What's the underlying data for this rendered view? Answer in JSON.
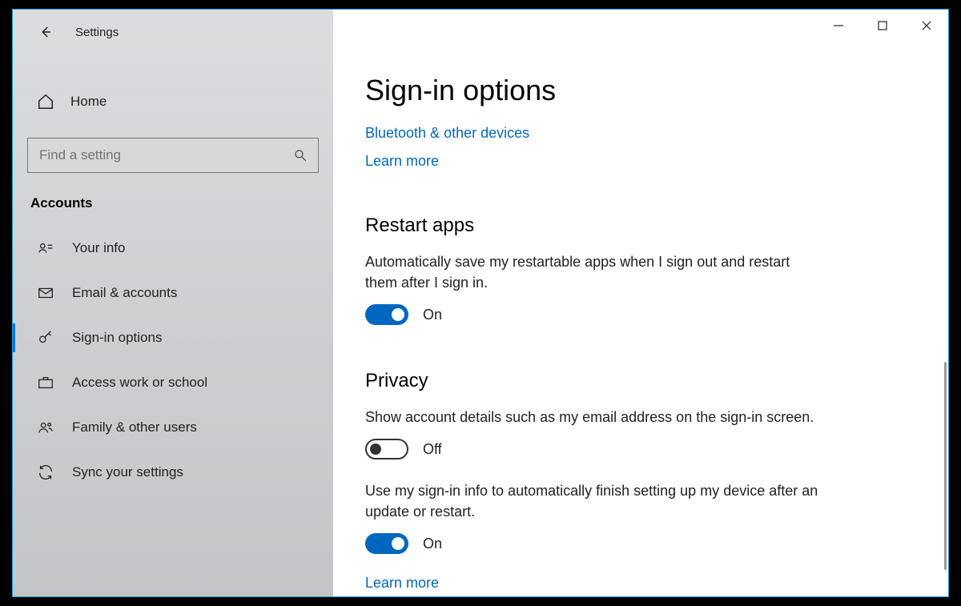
{
  "window": {
    "app_title": "Settings"
  },
  "sidebar": {
    "home_label": "Home",
    "search_placeholder": "Find a setting",
    "section_label": "Accounts",
    "items": [
      {
        "label": "Your info"
      },
      {
        "label": "Email & accounts"
      },
      {
        "label": "Sign-in options"
      },
      {
        "label": "Access work or school"
      },
      {
        "label": "Family & other users"
      },
      {
        "label": "Sync your settings"
      }
    ]
  },
  "main": {
    "title": "Sign-in options",
    "links": {
      "bluetooth": "Bluetooth & other devices",
      "learn_more_top": "Learn more"
    },
    "restart": {
      "heading": "Restart apps",
      "desc": "Automatically save my restartable apps when I sign out and restart them after I sign in.",
      "toggle_state": "On"
    },
    "privacy": {
      "heading": "Privacy",
      "show_details_desc": "Show account details such as my email address on the sign-in screen.",
      "show_details_state": "Off",
      "use_signin_desc": "Use my sign-in info to automatically finish setting up my device after an update or restart.",
      "use_signin_state": "On",
      "learn_more": "Learn more"
    }
  }
}
